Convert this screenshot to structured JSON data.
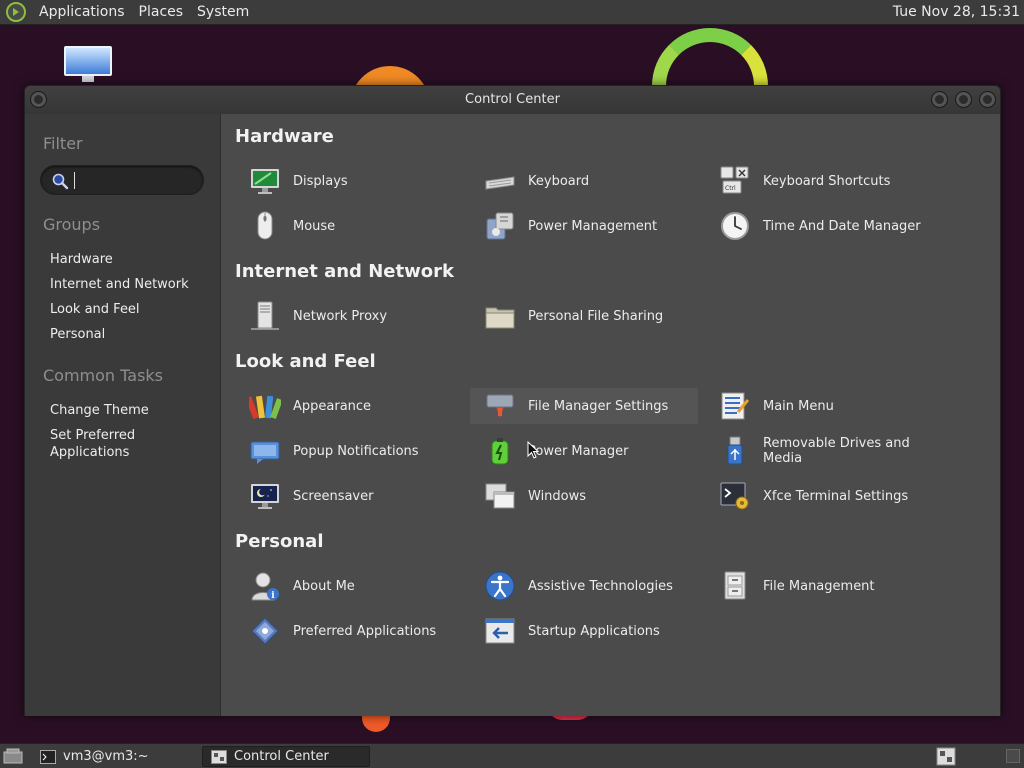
{
  "top_panel": {
    "menus": [
      "Applications",
      "Places",
      "System"
    ],
    "clock": "Tue Nov 28, 15:31"
  },
  "window": {
    "title": "Control Center"
  },
  "sidebar": {
    "filter_heading": "Filter",
    "search_value": "",
    "groups_heading": "Groups",
    "groups": [
      "Hardware",
      "Internet and Network",
      "Look and Feel",
      "Personal"
    ],
    "tasks_heading": "Common Tasks",
    "tasks": [
      "Change Theme",
      "Set Preferred Applications"
    ]
  },
  "sections": [
    {
      "title": "Hardware",
      "items": [
        {
          "label": "Displays",
          "icon": "display-icon"
        },
        {
          "label": "Keyboard",
          "icon": "keyboard-icon"
        },
        {
          "label": "Keyboard Shortcuts",
          "icon": "keyboard-shortcuts-icon"
        },
        {
          "label": "Mouse",
          "icon": "mouse-icon"
        },
        {
          "label": "Power Management",
          "icon": "power-management-icon"
        },
        {
          "label": "Time And Date Manager",
          "icon": "clock-icon"
        }
      ]
    },
    {
      "title": "Internet and Network",
      "items": [
        {
          "label": "Network Proxy",
          "icon": "network-proxy-icon"
        },
        {
          "label": "Personal File Sharing",
          "icon": "folder-share-icon"
        }
      ]
    },
    {
      "title": "Look and Feel",
      "items": [
        {
          "label": "Appearance",
          "icon": "appearance-icon"
        },
        {
          "label": "File Manager Settings",
          "icon": "file-manager-icon"
        },
        {
          "label": "Main Menu",
          "icon": "main-menu-icon"
        },
        {
          "label": "Popup Notifications",
          "icon": "notification-icon"
        },
        {
          "label": "Power Manager",
          "icon": "battery-icon"
        },
        {
          "label": "Removable Drives and Media",
          "icon": "usb-drive-icon"
        },
        {
          "label": "Screensaver",
          "icon": "screensaver-icon"
        },
        {
          "label": "Windows",
          "icon": "windows-icon"
        },
        {
          "label": "Xfce Terminal Settings",
          "icon": "terminal-settings-icon"
        }
      ]
    },
    {
      "title": "Personal",
      "items": [
        {
          "label": "About Me",
          "icon": "user-info-icon"
        },
        {
          "label": "Assistive Technologies",
          "icon": "accessibility-icon"
        },
        {
          "label": "File Management",
          "icon": "file-cabinet-icon"
        },
        {
          "label": "Preferred Applications",
          "icon": "preferred-apps-icon"
        },
        {
          "label": "Startup Applications",
          "icon": "startup-apps-icon"
        }
      ]
    }
  ],
  "bottom_panel": {
    "tasks": [
      "vm3@vm3:~",
      "Control Center"
    ]
  }
}
